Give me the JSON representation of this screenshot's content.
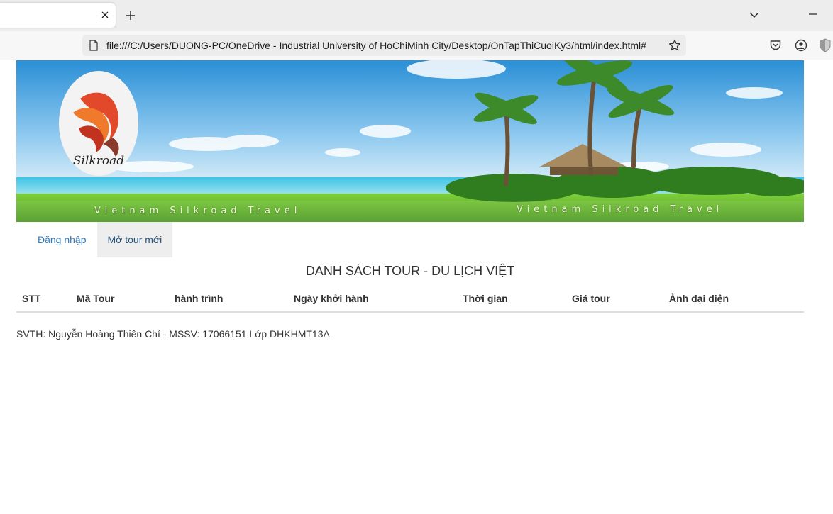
{
  "browser": {
    "tab_close_glyph": "✕",
    "new_tab_glyph": "+",
    "url": "file:///C:/Users/DUONG-PC/OneDrive - Industrial University of HoChiMinh City/Desktop/OnTapThiCuoiKy3/html/index.html#",
    "icons": [
      "page-icon",
      "star-icon",
      "pocket-icon",
      "account-icon",
      "shield-icon",
      "chevron-down-icon",
      "minimize-icon"
    ]
  },
  "banner": {
    "logo_text": "Silkroad",
    "caption_left": "Vietnam Silkroad Travel",
    "caption_right": "Vietnam Silkroad Travel"
  },
  "nav": {
    "items": [
      {
        "label": "Đăng nhập"
      },
      {
        "label": "Mở tour mới"
      }
    ]
  },
  "heading": "DANH SÁCH TOUR - DU LỊCH VIỆT",
  "table": {
    "columns": [
      "STT",
      "Mã Tour",
      "hành trình",
      "Ngày khởi hành",
      "Thời gian",
      "Giá tour",
      "Ảnh đại diện"
    ],
    "rows": []
  },
  "footer": "SVTH: Nguyễn Hoàng Thiên Chí - MSSV: 17066151 Lớp DHKHMT13A"
}
